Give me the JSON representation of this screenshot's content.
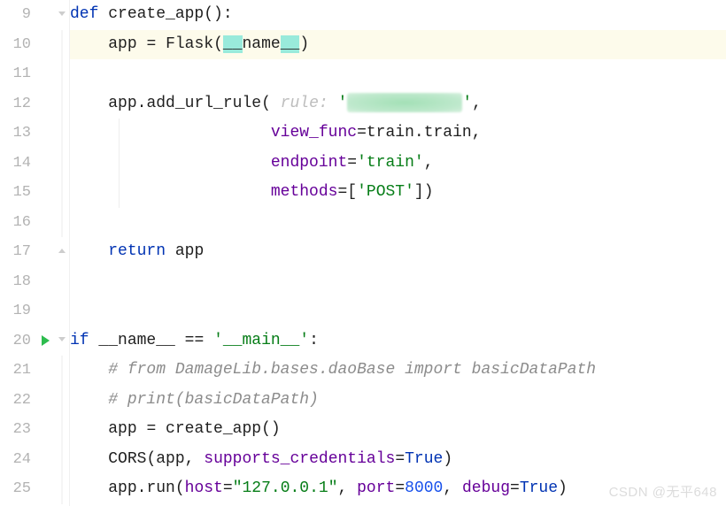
{
  "line_numbers": [
    "9",
    "10",
    "11",
    "12",
    "13",
    "14",
    "15",
    "16",
    "17",
    "18",
    "19",
    "20",
    "21",
    "22",
    "23",
    "24",
    "25"
  ],
  "code": {
    "l9": {
      "kw": "def",
      "name": "create_app",
      "rest": "():"
    },
    "l10": {
      "lhs": "app ",
      "eq": "=",
      "sp": " ",
      "cls": "Flask",
      "lp": "(",
      "dun": "__name__",
      "rp": ")",
      "hl_pre": "__",
      "hl_mid": "name",
      "hl_post": "__"
    },
    "l12": {
      "obj": "app",
      "dot": ".",
      "m": "add_url_rule",
      "lp": "(",
      "hint": "rule:",
      "sp": " ",
      "q1": "'",
      "redact": true,
      "q2": "'",
      "comma": ","
    },
    "l13": {
      "kw": "view_func",
      "eq": "=",
      "v": "train",
      "dot": ".",
      "m": "train",
      "comma": ","
    },
    "l14": {
      "kw": "endpoint",
      "eq": "=",
      "str": "'train'",
      "comma": ","
    },
    "l15": {
      "kw": "methods",
      "eq": "=",
      "lb": "[",
      "str": "'POST'",
      "rb": "]",
      "rp": ")"
    },
    "l17": {
      "kw": "return",
      "id": "app"
    },
    "l20": {
      "kw": "if",
      "dun": "__name__",
      "eq": " == ",
      "str": "'__main__'",
      "colon": ":"
    },
    "l21": {
      "cmt": "# from DamageLib.bases.daoBase import basicDataPath"
    },
    "l22": {
      "cmt": "# print(basicDataPath)"
    },
    "l23": {
      "lhs": "app ",
      "eq": "=",
      "rhs": " create_app()"
    },
    "l24": {
      "fn": "CORS",
      "lp": "(",
      "a1": "app",
      "c": ", ",
      "kw": "supports_credentials",
      "eq2": "=",
      "v": "True",
      "rp": ")"
    },
    "l25": {
      "obj": "app",
      "dot": ".",
      "m": "run",
      "lp": "(",
      "k1": "host",
      "e": "=",
      "s1": "\"127.0.0.1\"",
      "c1": ", ",
      "k2": "port",
      "n": "8000",
      "c2": ", ",
      "k3": "debug",
      "v3": "True",
      "rp": ")"
    }
  },
  "watermark": "CSDN @无平648"
}
